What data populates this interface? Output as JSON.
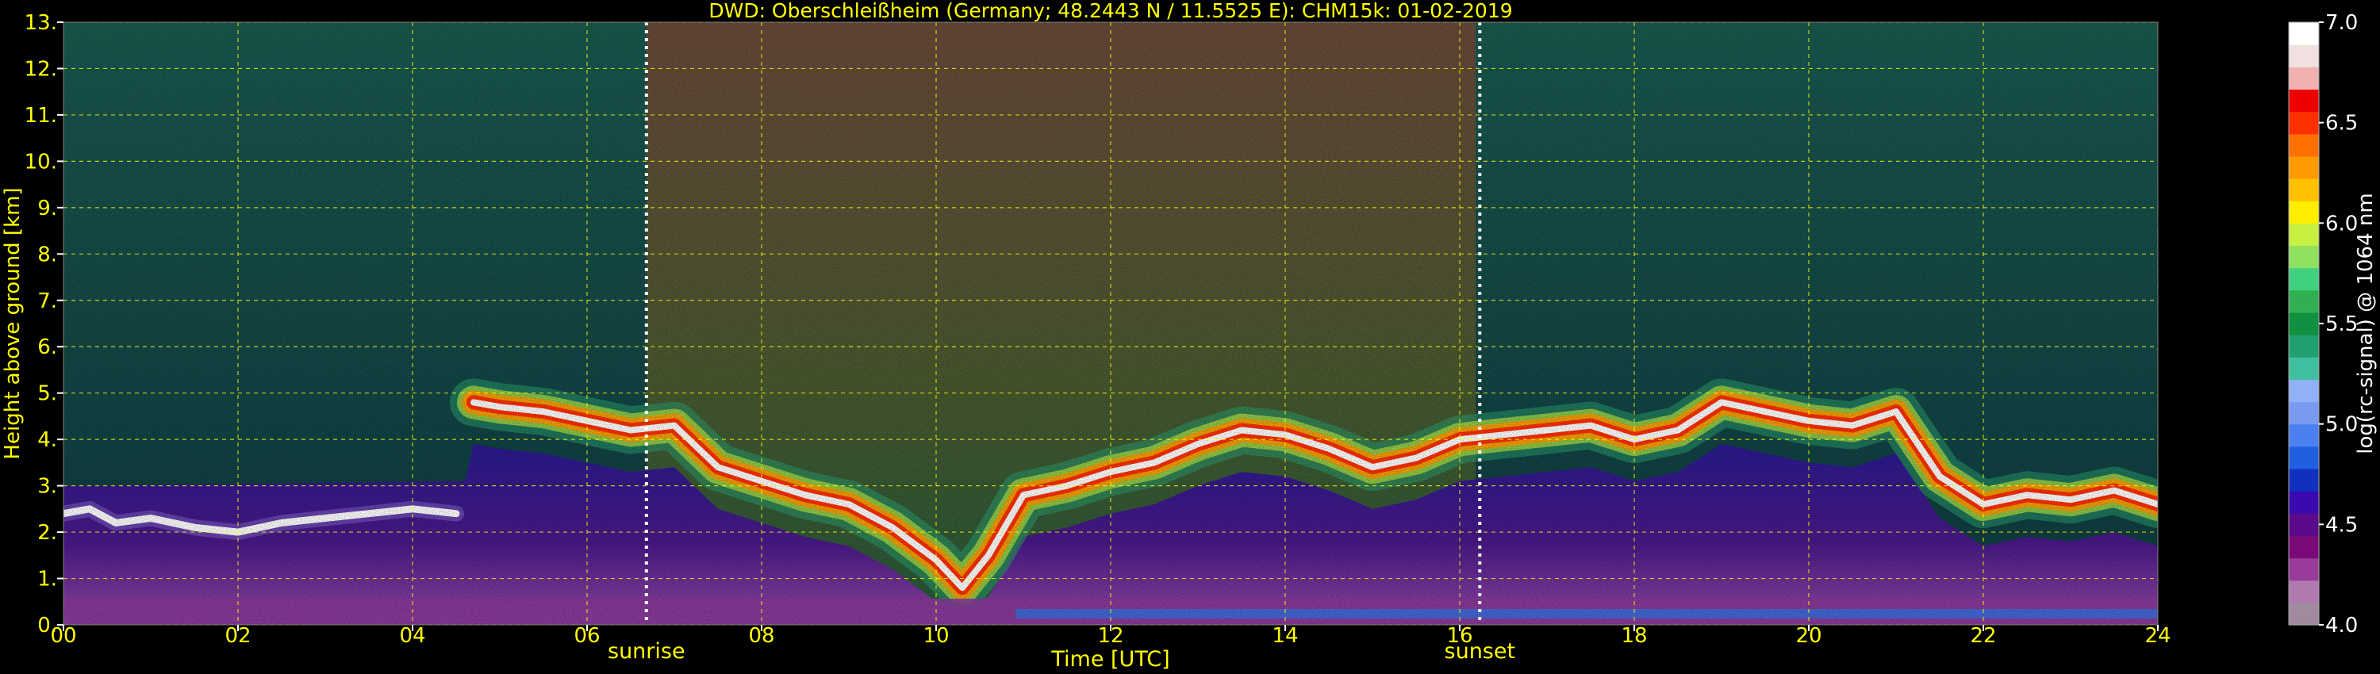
{
  "chart_data": {
    "type": "heatmap",
    "title": "DWD: Oberschleißheim (Germany; 48.2443 N / 11.5525 E):    CHM15k: 01-02-2019",
    "xlabel": "Time [UTC]",
    "ylabel": "Height above ground [km]",
    "xlim": [
      0,
      24
    ],
    "ylim": [
      0,
      13
    ],
    "x_ticks": [
      "00",
      "02",
      "04",
      "06",
      "08",
      "10",
      "12",
      "14",
      "16",
      "18",
      "20",
      "22",
      "24"
    ],
    "x_tick_values": [
      0,
      2,
      4,
      6,
      8,
      10,
      12,
      14,
      16,
      18,
      20,
      22,
      24
    ],
    "y_ticks": [
      "0.",
      "1.",
      "2.",
      "3.",
      "4.",
      "5.",
      "6.",
      "7.",
      "8.",
      "9.",
      "10.",
      "11.",
      "12.",
      "13."
    ],
    "y_tick_values": [
      0,
      1,
      2,
      3,
      4,
      5,
      6,
      7,
      8,
      9,
      10,
      11,
      12,
      13
    ],
    "grid": true,
    "markers": [
      {
        "label": "sunrise",
        "time": 6.68
      },
      {
        "label": "sunset",
        "time": 16.23
      }
    ],
    "colorbar": {
      "label": "log(rc-signal) @ 1064 nm",
      "range": [
        4.0,
        7.0
      ],
      "ticks": [
        "4.0",
        "4.5",
        "5.0",
        "5.5",
        "6.0",
        "6.5",
        "7.0"
      ],
      "tick_values": [
        4.0,
        4.5,
        5.0,
        5.5,
        6.0,
        6.5,
        7.0
      ],
      "colors": [
        "#a08aa0",
        "#b07ab0",
        "#9a3a9a",
        "#7a0a7a",
        "#5a0a8a",
        "#3a0ab0",
        "#1030c0",
        "#2060e0",
        "#4a80f0",
        "#7a9af0",
        "#90b0f8",
        "#40c0a0",
        "#20a070",
        "#109040",
        "#30b050",
        "#40d080",
        "#90e060",
        "#c8f040",
        "#ffee00",
        "#ffc000",
        "#ff9a00",
        "#ff7000",
        "#ff3000",
        "#ee0000",
        "#f0b0b0",
        "#f0e0e0",
        "#ffffff"
      ]
    },
    "background_colors": {
      "night": "#0d4038",
      "day": "#5a4a30",
      "boundary_layer": "#3a1a7a",
      "surface": "#8a3a9a"
    },
    "series": [
      {
        "points": [
          [
            0.0,
            2.4
          ],
          [
            0.3,
            2.5
          ],
          [
            0.6,
            2.2
          ],
          [
            1.0,
            2.3
          ],
          [
            1.5,
            2.1
          ],
          [
            2.0,
            2.0
          ],
          [
            2.5,
            2.2
          ],
          [
            3.0,
            2.3
          ],
          [
            3.5,
            2.4
          ],
          [
            4.0,
            2.5
          ],
          [
            4.5,
            2.4
          ]
        ]
      },
      {
        "points": [
          [
            4.7,
            4.8
          ],
          [
            5.0,
            4.7
          ],
          [
            5.5,
            4.6
          ],
          [
            6.0,
            4.4
          ],
          [
            6.5,
            4.2
          ],
          [
            7.0,
            4.3
          ],
          [
            7.5,
            3.4
          ],
          [
            8.0,
            3.1
          ],
          [
            8.5,
            2.8
          ],
          [
            9.0,
            2.6
          ],
          [
            9.5,
            2.1
          ],
          [
            10.0,
            1.4
          ],
          [
            10.3,
            0.8
          ],
          [
            10.6,
            1.5
          ],
          [
            11.0,
            2.8
          ],
          [
            11.5,
            3.0
          ],
          [
            12.0,
            3.3
          ],
          [
            12.5,
            3.5
          ],
          [
            13.0,
            3.9
          ],
          [
            13.5,
            4.2
          ],
          [
            14.0,
            4.1
          ],
          [
            14.5,
            3.8
          ],
          [
            15.0,
            3.4
          ],
          [
            15.5,
            3.6
          ],
          [
            16.0,
            4.0
          ],
          [
            16.5,
            4.1
          ],
          [
            17.0,
            4.2
          ],
          [
            17.5,
            4.3
          ],
          [
            18.0,
            4.0
          ],
          [
            18.5,
            4.2
          ],
          [
            19.0,
            4.8
          ],
          [
            19.5,
            4.6
          ],
          [
            20.0,
            4.4
          ],
          [
            20.5,
            4.3
          ],
          [
            21.0,
            4.6
          ],
          [
            21.5,
            3.2
          ],
          [
            22.0,
            2.6
          ],
          [
            22.5,
            2.8
          ],
          [
            23.0,
            2.7
          ],
          [
            23.5,
            2.9
          ],
          [
            24.0,
            2.6
          ]
        ]
      }
    ]
  }
}
